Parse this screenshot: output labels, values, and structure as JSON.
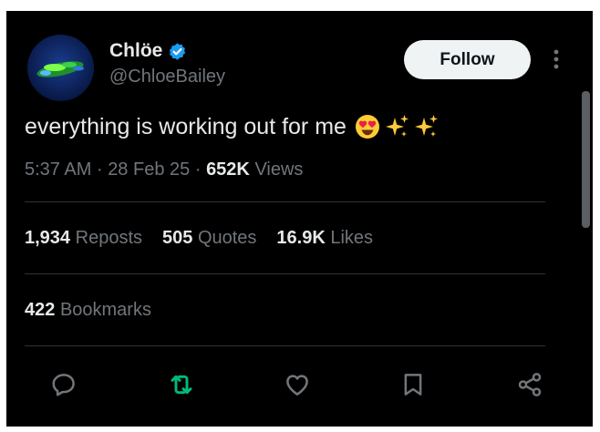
{
  "author": {
    "name": "Chlöe",
    "handle": "@ChloeBailey",
    "verified": true
  },
  "follow_label": "Follow",
  "tweet": {
    "text": "everything is working out for me",
    "emojis": [
      "heart-eyes",
      "sparkles",
      "sparkles"
    ]
  },
  "meta": {
    "time": "5:37 AM",
    "date": "28 Feb 25",
    "views_count": "652K",
    "views_label": "Views",
    "separator": "·"
  },
  "stats": {
    "reposts_count": "1,934",
    "reposts_label": "Reposts",
    "quotes_count": "505",
    "quotes_label": "Quotes",
    "likes_count": "16.9K",
    "likes_label": "Likes",
    "bookmarks_count": "422",
    "bookmarks_label": "Bookmarks"
  },
  "actions": [
    "reply-icon",
    "repost-icon",
    "like-icon",
    "bookmark-icon",
    "share-icon"
  ],
  "colors": {
    "background": "#000000",
    "text_primary": "#e7e9ea",
    "text_secondary": "#71767b",
    "verified": "#1d9bf0",
    "repost_active": "#00ba7c",
    "divider": "#2f3336"
  }
}
